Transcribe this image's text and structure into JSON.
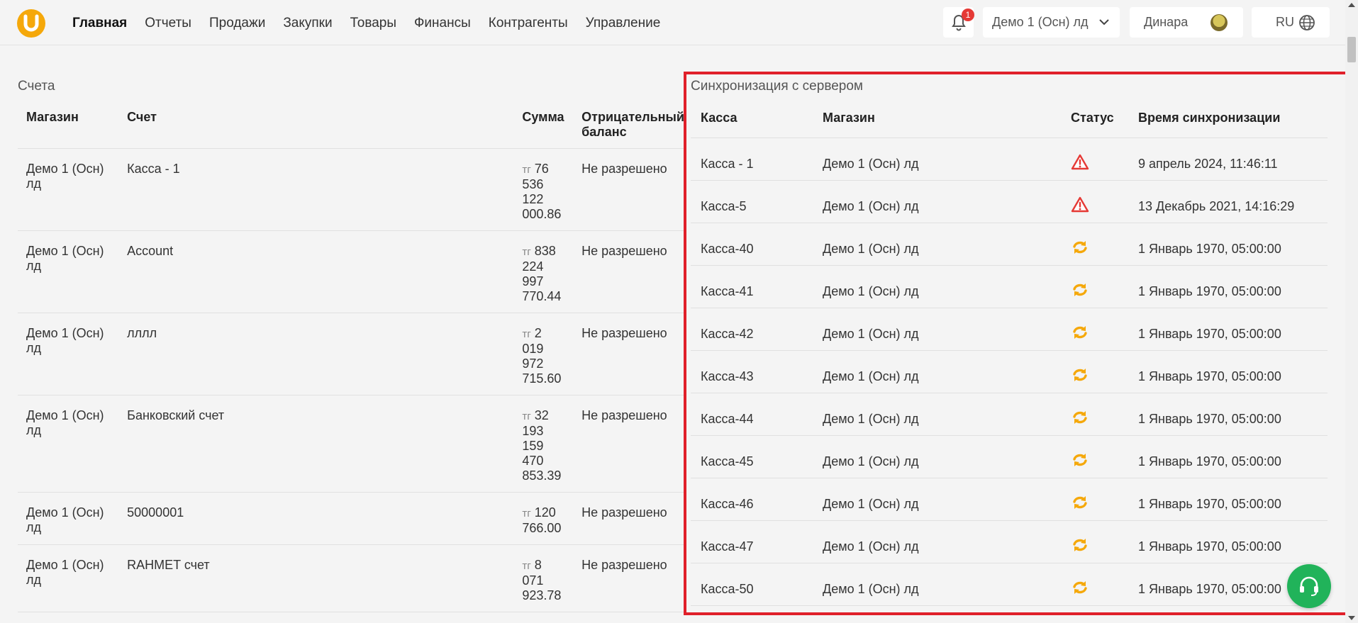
{
  "nav": {
    "items": [
      "Главная",
      "Отчеты",
      "Продажи",
      "Закупки",
      "Товары",
      "Финансы",
      "Контрагенты",
      "Управление"
    ],
    "active": "Главная"
  },
  "header": {
    "notifications_count": "1",
    "store_selector": "Демо 1 (Осн) лд",
    "user_name": "Динара",
    "language": "RU"
  },
  "accounts": {
    "title": "Счета",
    "columns": [
      "Магазин",
      "Счет",
      "Сумма",
      "Отрицательный баланс"
    ],
    "rows": [
      {
        "store": "Демо 1 (Осн) лд",
        "account": "Касса - 1",
        "currency": "тг",
        "sum": "76 536 122 000.86",
        "negative": "Не разрешено"
      },
      {
        "store": "Демо 1 (Осн) лд",
        "account": "Account",
        "currency": "тг",
        "sum": "838 224 997 770.44",
        "negative": "Не разрешено"
      },
      {
        "store": "Демо 1 (Осн) лд",
        "account": "лллл",
        "currency": "тг",
        "sum": "2 019 972 715.60",
        "negative": "Не разрешено"
      },
      {
        "store": "Демо 1 (Осн) лд",
        "account": "Банковский счет",
        "currency": "тг",
        "sum": "32 193 159 470 853.39",
        "negative": "Не разрешено"
      },
      {
        "store": "Демо 1 (Осн) лд",
        "account": "50000001",
        "currency": "тг",
        "sum": "120 766.00",
        "negative": "Не разрешено"
      },
      {
        "store": "Демо 1 (Осн) лд",
        "account": "RAHMET счет",
        "currency": "тг",
        "sum": "8 071 923.78",
        "negative": "Не разрешено"
      }
    ]
  },
  "sync": {
    "title": "Синхронизация с сервером",
    "columns": [
      "Касса",
      "Магазин",
      "Статус",
      "Время синхронизации"
    ],
    "rows": [
      {
        "cash": "Касса - 1",
        "store": "Демо 1 (Осн) лд",
        "status": "warning-icon",
        "time": "9 апрель 2024, 11:46:11"
      },
      {
        "cash": "Касса-5",
        "store": "Демо 1 (Осн) лд",
        "status": "warning-icon",
        "time": "13 Декабрь 2021, 14:16:29"
      },
      {
        "cash": "Касса-40",
        "store": "Демо 1 (Осн) лд",
        "status": "sync-icon",
        "time": "1 Январь 1970, 05:00:00"
      },
      {
        "cash": "Касса-41",
        "store": "Демо 1 (Осн) лд",
        "status": "sync-icon",
        "time": "1 Январь 1970, 05:00:00"
      },
      {
        "cash": "Касса-42",
        "store": "Демо 1 (Осн) лд",
        "status": "sync-icon",
        "time": "1 Январь 1970, 05:00:00"
      },
      {
        "cash": "Касса-43",
        "store": "Демо 1 (Осн) лд",
        "status": "sync-icon",
        "time": "1 Январь 1970, 05:00:00"
      },
      {
        "cash": "Касса-44",
        "store": "Демо 1 (Осн) лд",
        "status": "sync-icon",
        "time": "1 Январь 1970, 05:00:00"
      },
      {
        "cash": "Касса-45",
        "store": "Демо 1 (Осн) лд",
        "status": "sync-icon",
        "time": "1 Январь 1970, 05:00:00"
      },
      {
        "cash": "Касса-46",
        "store": "Демо 1 (Осн) лд",
        "status": "sync-icon",
        "time": "1 Январь 1970, 05:00:00"
      },
      {
        "cash": "Касса-47",
        "store": "Демо 1 (Осн) лд",
        "status": "sync-icon",
        "time": "1 Январь 1970, 05:00:00"
      },
      {
        "cash": "Касса-50",
        "store": "Демо 1 (Осн) лд",
        "status": "sync-icon",
        "time": "1 Январь 1970, 05:00:00"
      }
    ]
  },
  "colors": {
    "brand": "#f5a80a",
    "warning": "#e53935",
    "sync": "#f5a80a",
    "highlight": "#e0202a",
    "support": "#21b35a"
  },
  "icons": {
    "logo": "logo-icon",
    "bell": "bell-icon",
    "chevron": "chevron-down-icon",
    "globe": "globe-icon",
    "support": "headset-icon"
  }
}
